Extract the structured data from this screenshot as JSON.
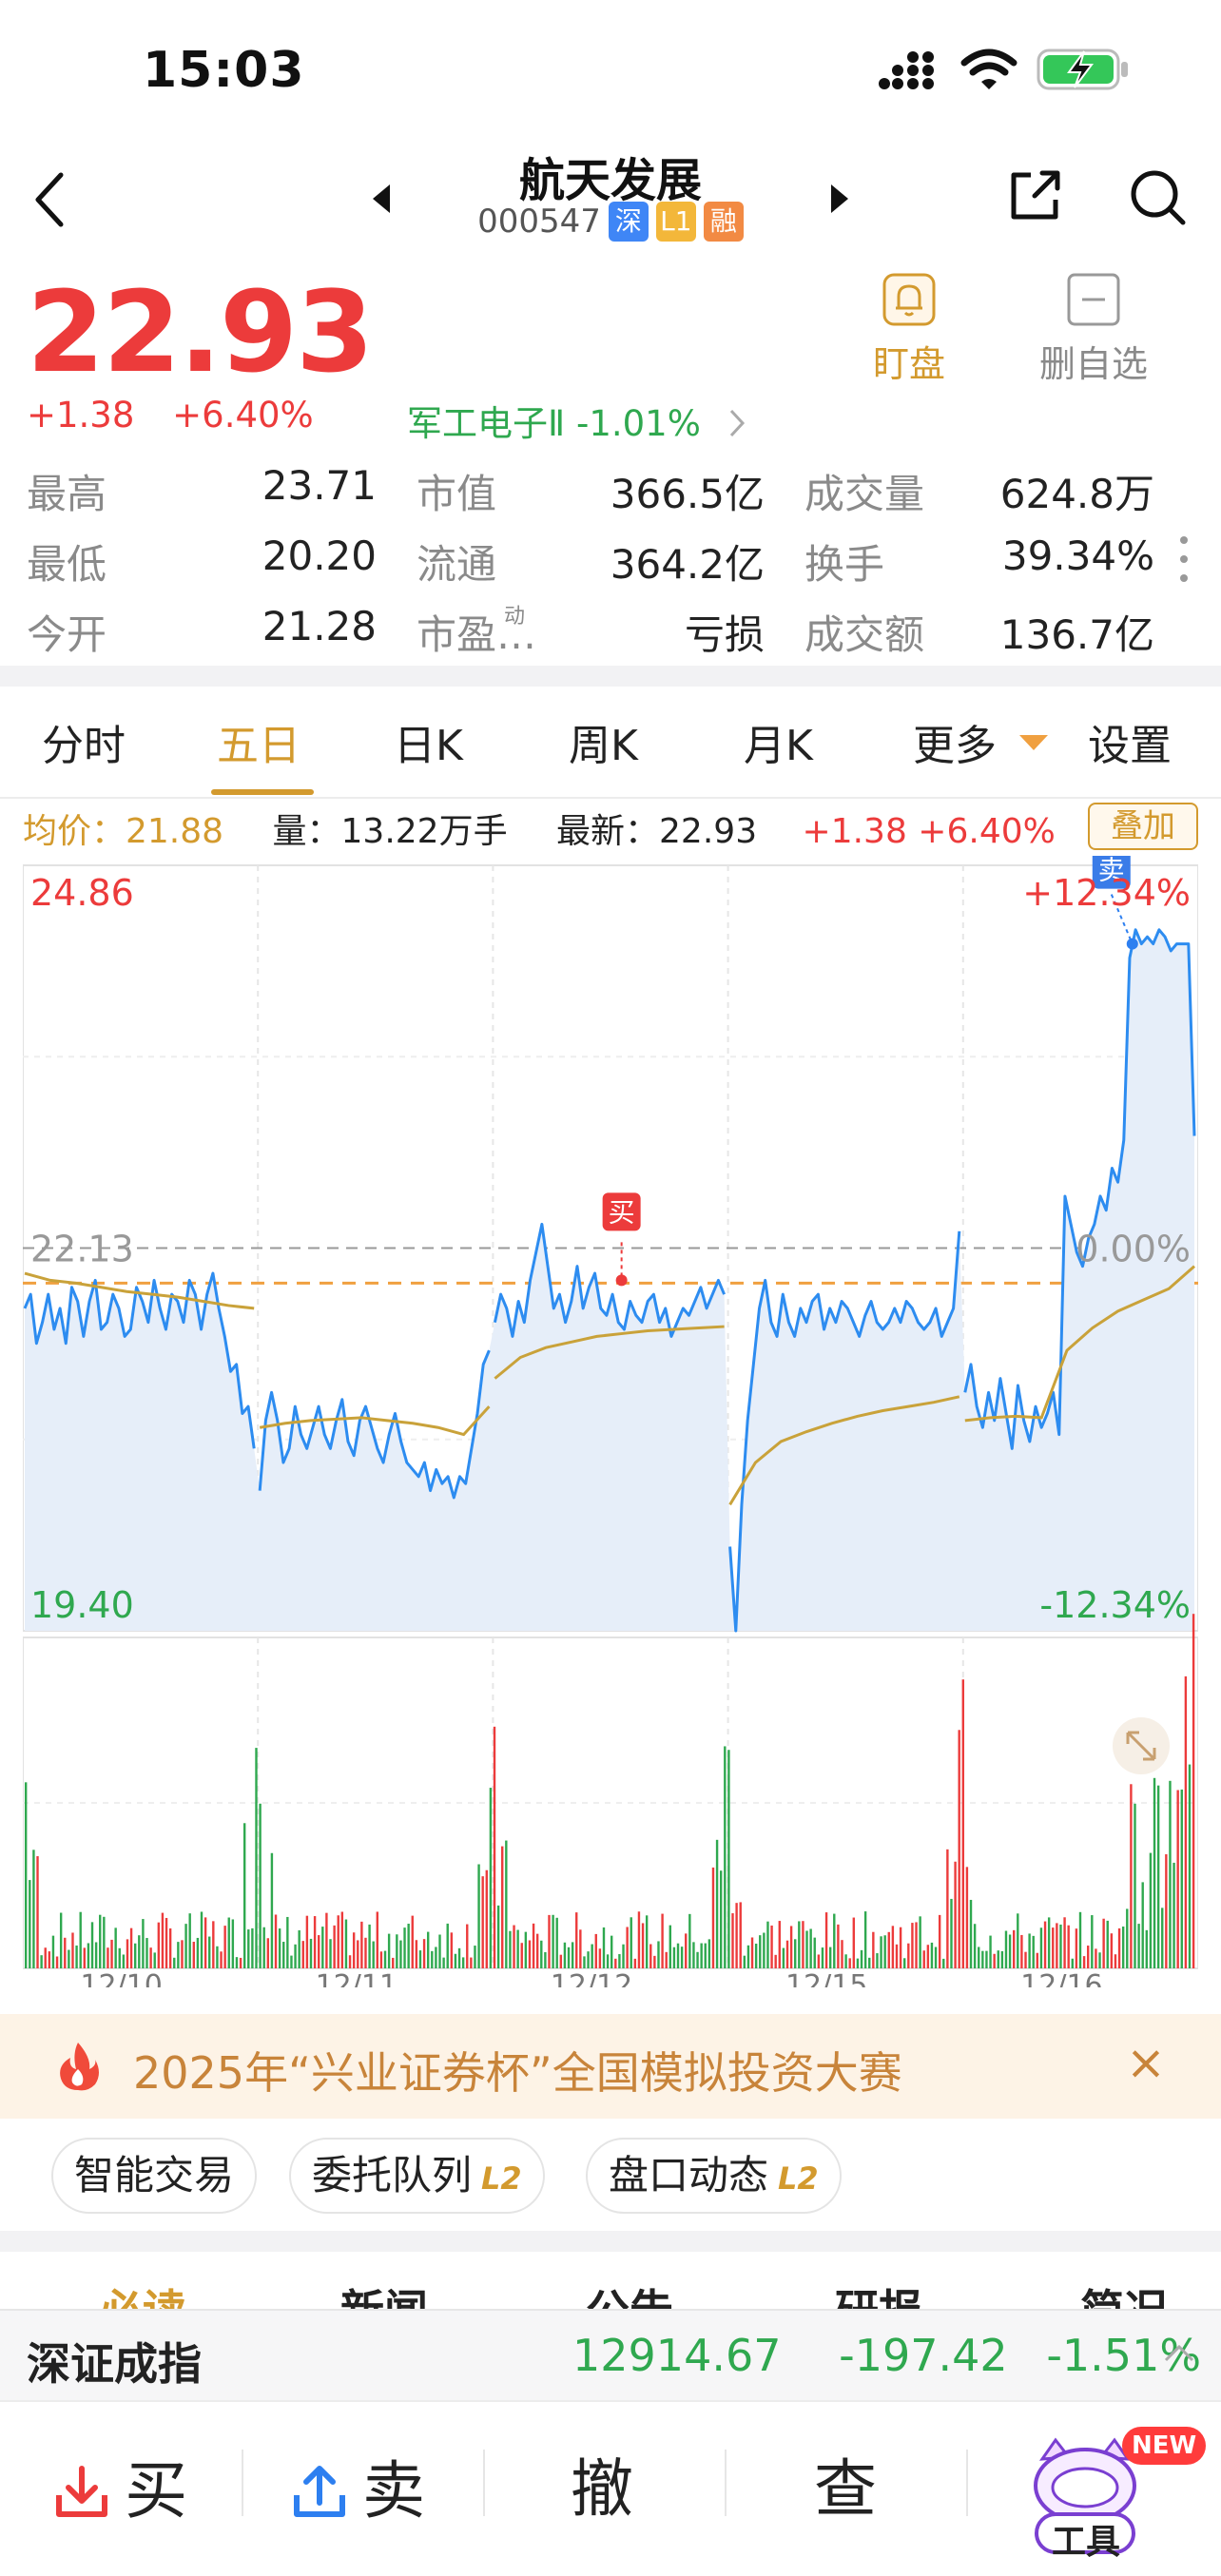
{
  "status_bar": {
    "time": "15:03"
  },
  "nav": {
    "stock_name": "航天发展",
    "stock_code": "000547",
    "tags": [
      "深",
      "L1",
      "融"
    ]
  },
  "quote": {
    "price": "22.93",
    "change": "+1.38",
    "change_pct": "+6.40%",
    "sector": "军工电子Ⅱ -1.01%",
    "watch_label": "盯盘",
    "remove_watch_label": "删自选"
  },
  "stats": [
    {
      "label": "最高",
      "value": "23.71",
      "color": "red"
    },
    {
      "label": "市值",
      "value": "366.5亿",
      "color": "default"
    },
    {
      "label": "成交量",
      "value": "624.8万",
      "color": "default"
    },
    {
      "label": "最低",
      "value": "20.20",
      "color": "green"
    },
    {
      "label": "流通",
      "value": "364.2亿",
      "color": "default"
    },
    {
      "label": "换手",
      "value": "39.34%",
      "color": "default"
    },
    {
      "label": "今开",
      "value": "21.28",
      "color": "green"
    },
    {
      "label": "市盈…",
      "value": "亏损",
      "color": "default"
    },
    {
      "label": "成交额",
      "value": "136.7亿",
      "color": "default"
    }
  ],
  "stats_pe_sup": "动",
  "tabs": [
    "分时",
    "五日",
    "日K",
    "周K",
    "月K",
    "更多",
    "设置"
  ],
  "active_tab": "五日",
  "info_line": {
    "avg": "均价：21.88",
    "volume": "量：13.22万手",
    "latest": "最新：22.93",
    "change": "+1.38 +6.40%",
    "overlay": "叠加"
  },
  "chart_data": {
    "type": "line",
    "title": "",
    "y_top_label": "24.86",
    "y_mid_label": "22.13",
    "y_bottom_label": "19.40",
    "pct_top_label": "+12.34%",
    "pct_mid_label": "0.00%",
    "pct_bottom_label": "-12.34%",
    "ylim": [
      19.4,
      24.86
    ],
    "prev_close": 22.13,
    "avg_ref_line": 21.88,
    "x_tick_labels": [
      "12/10",
      "12/11",
      "12/12",
      "12/15",
      "12/16"
    ],
    "markers": [
      {
        "label": "买",
        "day": "12/12",
        "price": 21.9
      },
      {
        "label": "卖",
        "day": "12/16",
        "price": 24.3
      }
    ],
    "series": [
      {
        "name": "price",
        "days": [
          [
            21.7,
            21.8,
            21.45,
            21.6,
            21.8,
            21.55,
            21.7,
            21.45,
            21.85,
            21.75,
            21.5,
            21.75,
            21.9,
            21.55,
            21.6,
            21.8,
            21.7,
            21.5,
            21.55,
            21.85,
            21.75,
            21.6,
            21.9,
            21.7,
            21.55,
            21.8,
            21.75,
            21.6,
            21.9,
            21.8,
            21.55,
            21.8,
            21.95,
            21.7,
            21.5,
            21.25,
            21.3,
            20.95,
            21.0,
            20.7
          ],
          [
            20.4,
            20.9,
            21.1,
            20.9,
            20.6,
            20.7,
            21.0,
            20.8,
            20.7,
            20.85,
            21.0,
            20.8,
            20.7,
            20.9,
            21.05,
            20.75,
            20.65,
            20.9,
            21.0,
            20.85,
            20.7,
            20.6,
            20.8,
            20.95,
            20.75,
            20.6,
            20.55,
            20.5,
            20.6,
            20.4,
            20.55,
            20.45,
            20.5,
            20.35,
            20.5,
            20.45,
            20.7,
            20.95,
            21.3,
            21.4
          ],
          [
            21.6,
            21.8,
            21.7,
            21.5,
            21.75,
            21.6,
            21.9,
            22.1,
            22.3,
            22.0,
            21.7,
            21.8,
            21.6,
            21.75,
            22.0,
            21.7,
            21.85,
            21.95,
            21.7,
            21.65,
            21.8,
            21.6,
            21.55,
            21.75,
            21.65,
            21.6,
            21.75,
            21.8,
            21.6,
            21.7,
            21.5,
            21.6,
            21.7,
            21.65,
            21.75,
            21.85,
            21.7,
            21.8,
            21.9,
            21.8
          ],
          [
            20.0,
            19.4,
            20.3,
            20.9,
            21.3,
            21.7,
            21.9,
            21.6,
            21.5,
            21.8,
            21.6,
            21.5,
            21.7,
            21.6,
            21.75,
            21.8,
            21.55,
            21.7,
            21.6,
            21.75,
            21.7,
            21.6,
            21.5,
            21.65,
            21.75,
            21.6,
            21.55,
            21.6,
            21.7,
            21.6,
            21.75,
            21.7,
            21.6,
            21.55,
            21.6,
            21.7,
            21.5,
            21.6,
            21.7,
            22.25
          ],
          [
            21.1,
            21.3,
            21.0,
            20.85,
            21.1,
            20.9,
            21.2,
            20.95,
            20.7,
            21.15,
            20.9,
            20.75,
            21.0,
            20.85,
            20.95,
            21.1,
            20.8,
            22.5,
            22.3,
            22.1,
            22.0,
            22.2,
            22.3,
            22.5,
            22.4,
            22.7,
            22.6,
            22.9,
            24.2,
            24.4,
            24.3,
            24.35,
            24.3,
            24.4,
            24.35,
            24.25,
            24.3,
            24.3,
            24.3,
            22.93
          ]
        ]
      },
      {
        "name": "avg",
        "days": [
          [
            21.95,
            21.9,
            21.88,
            21.85,
            21.82,
            21.8,
            21.78,
            21.75,
            21.72,
            21.7
          ],
          [
            20.85,
            20.88,
            20.9,
            20.91,
            20.92,
            20.9,
            20.88,
            20.85,
            20.8,
            21.0
          ],
          [
            21.2,
            21.35,
            21.42,
            21.46,
            21.5,
            21.52,
            21.54,
            21.55,
            21.56,
            21.57
          ],
          [
            20.3,
            20.6,
            20.75,
            20.82,
            20.88,
            20.93,
            20.97,
            21.0,
            21.03,
            21.07
          ],
          [
            20.9,
            20.92,
            20.93,
            20.92,
            21.4,
            21.56,
            21.68,
            21.76,
            21.84,
            22.0
          ]
        ]
      }
    ]
  },
  "banner": {
    "text": "2025年“兴业证券杯”全国模拟投资大赛",
    "close": "×"
  },
  "chips": [
    {
      "label": "智能交易",
      "badge": ""
    },
    {
      "label": "委托队列",
      "badge": "L2"
    },
    {
      "label": "盘口动态",
      "badge": "L2"
    }
  ],
  "section_tabs": [
    "必读",
    "新闻",
    "公告",
    "研报",
    "简况"
  ],
  "index_bar": {
    "name": "深证成指",
    "value": "12914.67",
    "change": "-197.42",
    "change_pct": "-1.51%"
  },
  "trade_bar": {
    "buy": "买",
    "sell": "卖",
    "cancel": "撤",
    "query": "查",
    "tools": "工具",
    "tools_badge": "NEW"
  },
  "colors": {
    "up_red": "#ec3b3b",
    "down_green": "#2fa84f",
    "accent_gold": "#d39a2e",
    "price_line_blue": "#2d8cf0",
    "avg_line": "#c9a23a",
    "ref_line_orange": "#f0a040"
  }
}
